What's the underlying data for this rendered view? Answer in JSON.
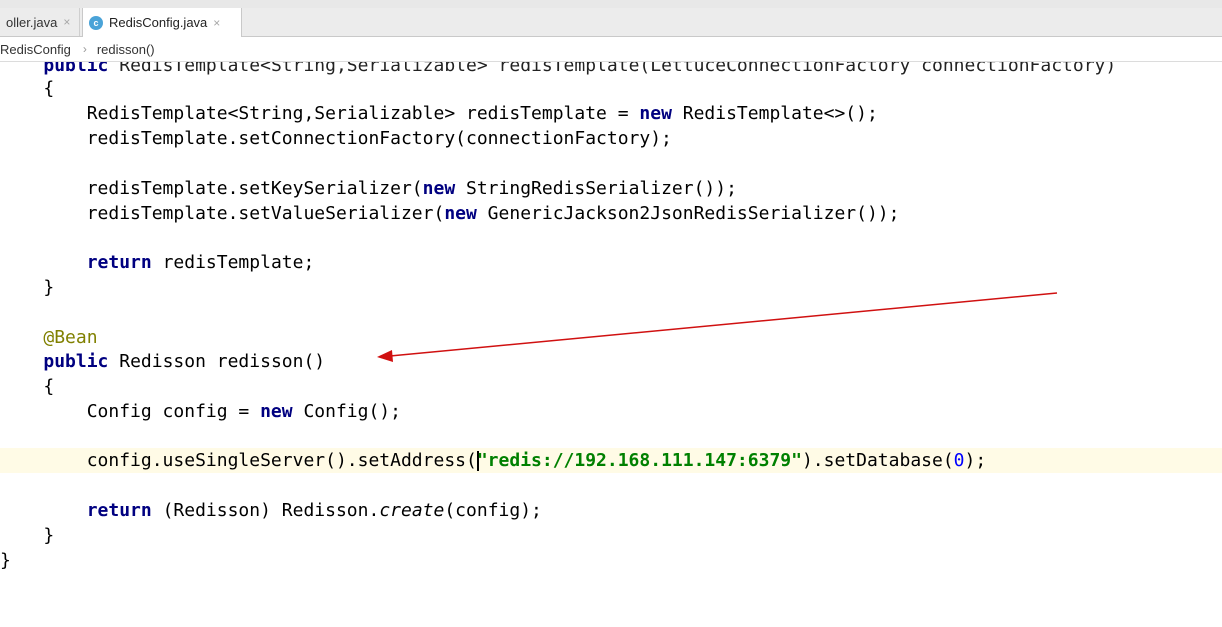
{
  "tabs": [
    {
      "label": "oller.java",
      "close": "×"
    },
    {
      "label": "RedisConfig.java",
      "close": "×",
      "icon_letter": "c"
    }
  ],
  "breadcrumb": {
    "class_name": "RedisConfig",
    "sep": "›",
    "method": "redisson()"
  },
  "code": {
    "l0": {
      "a": "public",
      "b": " RedisTemplate<String,Serializable> redisTemplate(LettuceConnectionFactory connectionFactory)"
    },
    "l1": {
      "a": "{"
    },
    "l2": {
      "a": "RedisTemplate<String,Serializable> redisTemplate = ",
      "kw": "new",
      "b": " RedisTemplate<>();"
    },
    "l3": {
      "a": "redisTemplate.setConnectionFactory(connectionFactory);"
    },
    "l5": {
      "a": "redisTemplate.setKeySerializer(",
      "kw": "new",
      "b": " StringRedisSerializer());"
    },
    "l6": {
      "a": "redisTemplate.setValueSerializer(",
      "kw": "new",
      "b": " GenericJackson2JsonRedisSerializer());"
    },
    "l8": {
      "kw": "return",
      "b": " redisTemplate;"
    },
    "l9": {
      "a": "}"
    },
    "l11": {
      "ann": "@Bean"
    },
    "l12": {
      "kw": "public",
      "b": " Redisson redisson()"
    },
    "l13": {
      "a": "{"
    },
    "l14": {
      "a": "Config config = ",
      "kw": "new",
      "b": " Config();"
    },
    "l16": {
      "a": "config.useSingleServer().setAddress(",
      "str": "\"redis://192.168.111.147:6379\"",
      "b": ").setDatabase(",
      "num": "0",
      "c": ");"
    },
    "l18": {
      "kw": "return",
      "b": " (Redisson) Redisson.",
      "ital": "create",
      "c": "(config);"
    },
    "l19": {
      "a": "}"
    },
    "l20": {
      "a": "}"
    }
  },
  "colors": {
    "keyword": "#000080",
    "string": "#008000",
    "annotation": "#808000",
    "number": "#0000ff",
    "arrow": "#d01010"
  }
}
